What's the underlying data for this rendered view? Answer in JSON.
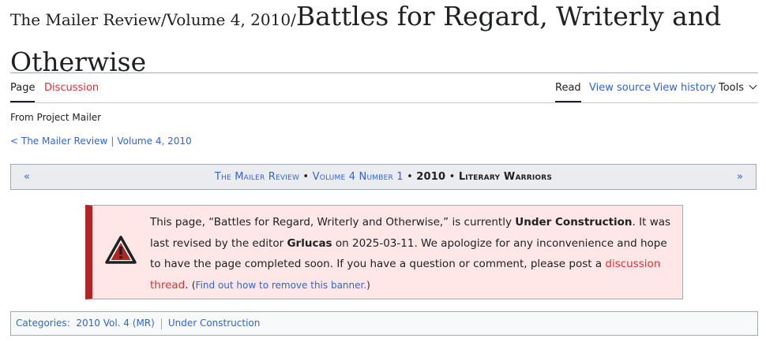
{
  "title": {
    "prefix": "The Mailer Review/Volume 4, 2010/",
    "main": "Battles for Regard, Writerly and Otherwise"
  },
  "tabs": {
    "page": "Page",
    "discussion": "Discussion",
    "read": "Read",
    "view_source": "View source",
    "view_history": "View history",
    "tools": "Tools"
  },
  "tagline": "From Project Mailer",
  "subpages": {
    "prefix": "< ",
    "link1": "The Mailer Review",
    "sep": "|",
    "link2": "Volume 4, 2010"
  },
  "navbox": {
    "prev": "«",
    "next": "»",
    "link1": "The Mailer Review",
    "dot": " • ",
    "link2": "Volume 4 Number 1",
    "year": "2010",
    "current": "Literary Warriors"
  },
  "banner": {
    "icon": "warning-triangle-icon",
    "part1": "This page, “Battles for Regard, Writerly and Otherwise,” is currently ",
    "status": "Under Construction",
    "part2": ". It was last revised by the editor ",
    "editor": "Grlucas",
    "part3": " on 2025-03-11. We apologize for any inconvenience and hope to have the page completed soon. If you have a question or comment, please post a ",
    "thread_link": "discussion thread",
    "part4": ". ",
    "paren_open": "(",
    "find_out": "Find out how to remove this banner.",
    "paren_close": ")"
  },
  "categories": {
    "label": "Categories",
    "colon": ":",
    "items": [
      "2010 Vol. 4 (MR)",
      "Under Construction"
    ]
  },
  "colors": {
    "link": "#3366cc",
    "red_link": "#dd3333",
    "banner_bg": "#fee7e6",
    "banner_border": "#b32424"
  }
}
